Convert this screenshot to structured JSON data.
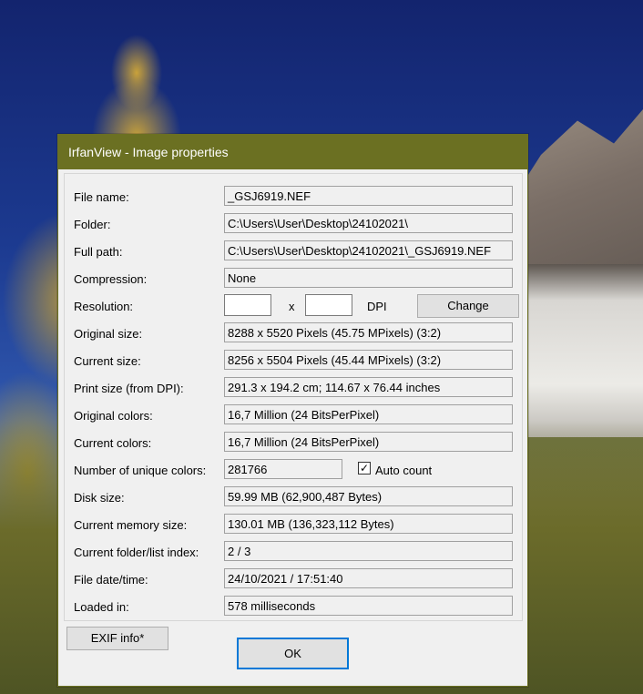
{
  "window": {
    "title": "IrfanView - Image properties"
  },
  "fields": [
    {
      "label": "File name:",
      "value": "_GSJ6919.NEF"
    },
    {
      "label": "Folder:",
      "value": "C:\\Users\\User\\Desktop\\24102021\\"
    },
    {
      "label": "Full path:",
      "value": "C:\\Users\\User\\Desktop\\24102021\\_GSJ6919.NEF"
    },
    {
      "label": "Compression:",
      "value": "None"
    },
    {
      "label": "Resolution:",
      "x_label": "x",
      "dpi_label": "DPI",
      "width_value": "",
      "height_value": "",
      "change_label": "Change"
    },
    {
      "label": "Original size:",
      "value": "8288 x 5520  Pixels (45.75 MPixels) (3:2)"
    },
    {
      "label": "Current size:",
      "value": "8256 x 5504  Pixels (45.44 MPixels) (3:2)"
    },
    {
      "label": "Print size (from DPI):",
      "value": "291.3 x 194.2 cm; 114.67 x 76.44 inches"
    },
    {
      "label": "Original colors:",
      "value": "16,7 Million   (24 BitsPerPixel)"
    },
    {
      "label": "Current colors:",
      "value": "16,7 Million   (24 BitsPerPixel)"
    },
    {
      "label": "Number of unique colors:",
      "value": "281766",
      "checkbox_label": "Auto count",
      "checkbox_checked": true
    },
    {
      "label": "Disk size:",
      "value": "59.99 MB (62,900,487 Bytes)"
    },
    {
      "label": "Current memory size:",
      "value": "130.01  MB (136,323,112 Bytes)"
    },
    {
      "label": "Current folder/list index:",
      "value": "2  /  3"
    },
    {
      "label": "File date/time:",
      "value": "24/10/2021 / 17:51:40"
    },
    {
      "label": "Loaded in:",
      "value": "578 milliseconds"
    }
  ],
  "buttons": {
    "exif": "EXIF info*",
    "ok": "OK"
  },
  "colors": {
    "titlebar": "#6b7022",
    "ok_border": "#0078d7"
  }
}
